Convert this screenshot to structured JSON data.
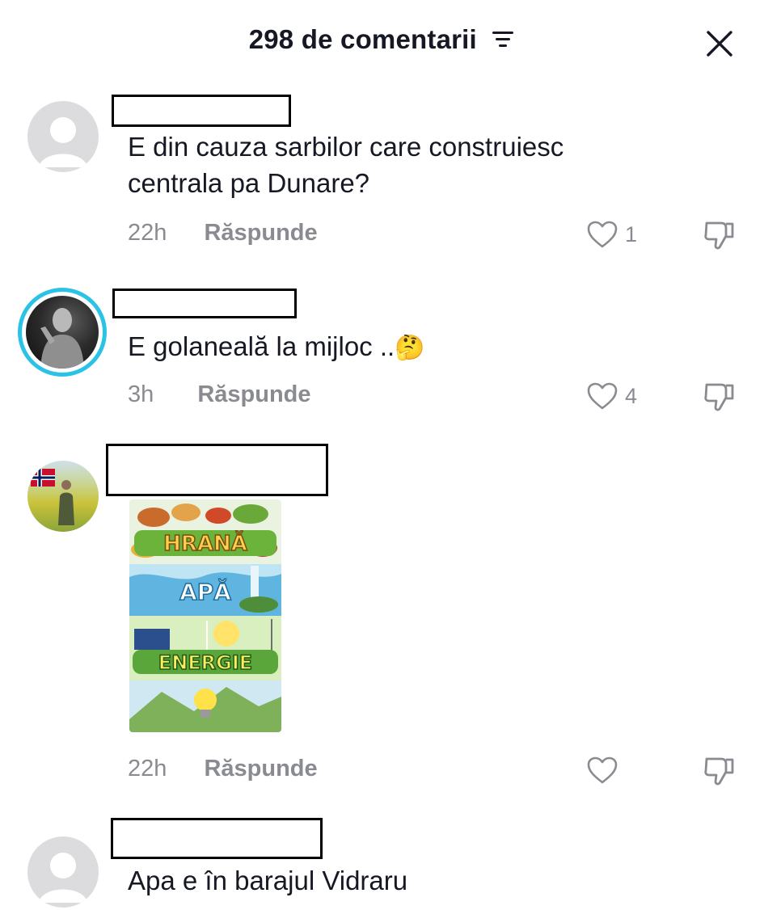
{
  "header": {
    "title": "298 de comentarii",
    "filter_icon": "sort-lines-icon",
    "close_icon": "close-x-icon"
  },
  "comments": [
    {
      "text_line1": "E din cauza sarbilor care construiesc",
      "text_line2": "centrala pa Dunare?",
      "time": "22h",
      "reply": "Răspunde",
      "likes": "1"
    },
    {
      "text": "E golaneală la mijloc ..",
      "emoji": "🤔",
      "time": "3h",
      "reply": "Răspunde",
      "likes": "4"
    },
    {
      "sticker_words": [
        "HRANĂ",
        "APĂ",
        "ENERGIE"
      ],
      "time": "22h",
      "reply": "Răspunde",
      "likes": ""
    },
    {
      "text": "Apa e în barajul Vidraru"
    }
  ],
  "colors": {
    "accent_story_ring": "#2ac3e6",
    "meta_gray": "#8a8b91",
    "text": "#161823"
  }
}
